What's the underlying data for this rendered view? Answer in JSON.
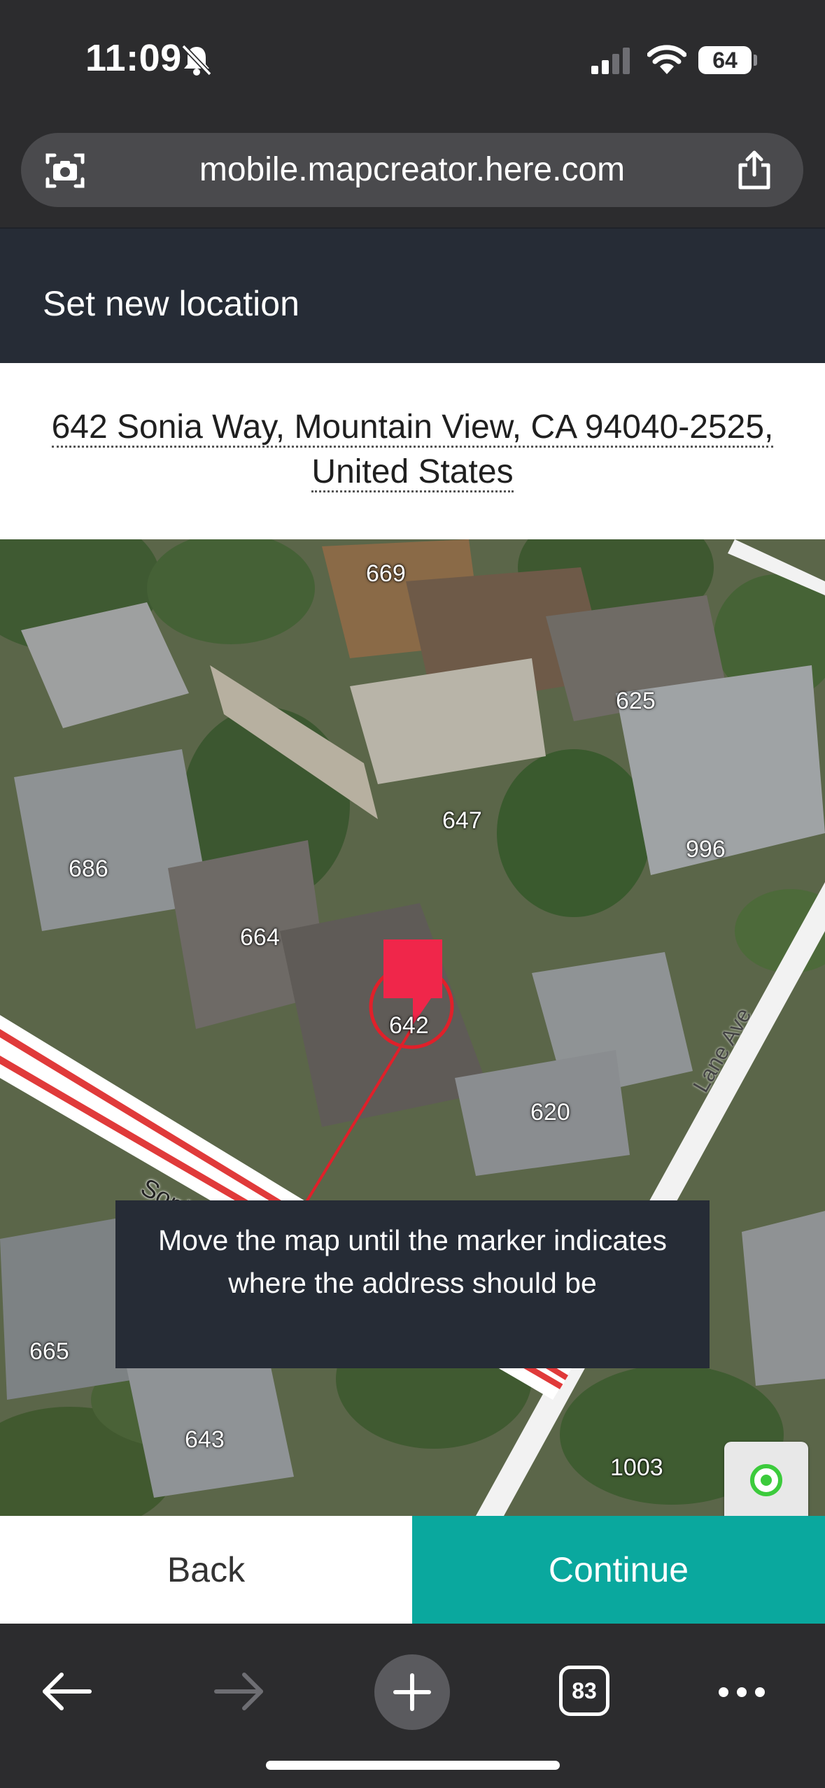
{
  "status_bar": {
    "time": "11:09",
    "battery": "64",
    "icons": [
      "bell-slash-icon",
      "signal-icon",
      "wifi-icon",
      "battery-icon"
    ]
  },
  "browser": {
    "url": "mobile.mapcreator.here.com",
    "tab_count": "83",
    "icons": [
      "camera-icon",
      "share-icon",
      "back-arrow-icon",
      "forward-arrow-icon",
      "plus-icon",
      "more-icon"
    ]
  },
  "header": {
    "title": "Set new location"
  },
  "address": {
    "line1": "642 Sonia Way, Mountain View, CA 94040-2525,",
    "line2": "United States"
  },
  "map": {
    "house_numbers": [
      "669",
      "625",
      "647",
      "996",
      "686",
      "664",
      "642",
      "620",
      "665",
      "643",
      "1003"
    ],
    "street_labels": [
      "Sonia Wa",
      "Lane Ave"
    ],
    "hint": "Move the map until the marker indicates where the address should be",
    "marker_color": "#f0264a"
  },
  "buttons": {
    "back": "Back",
    "continue": "Continue"
  },
  "colors": {
    "header_bg": "#262c36",
    "accent": "#0aa89e",
    "marker": "#f0264a"
  }
}
